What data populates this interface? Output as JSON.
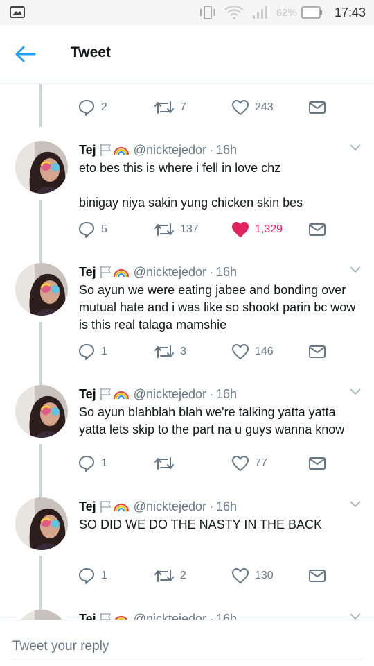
{
  "status_bar": {
    "battery_percent": "62%",
    "time": "17:43"
  },
  "app_bar": {
    "title": "Tweet"
  },
  "top_actions": {
    "replies": "2",
    "retweets": "7",
    "likes": "243"
  },
  "tweets": [
    {
      "name": "Tej",
      "handle": "@nicktejedor",
      "separator": "·",
      "time": "16h",
      "lines": [
        "eto bes this is where i fell in love chz",
        "binigay niya sakin yung chicken skin bes"
      ],
      "replies": "5",
      "retweets": "137",
      "likes": "1,329",
      "liked": true
    },
    {
      "name": "Tej",
      "handle": "@nicktejedor",
      "separator": "·",
      "time": "16h",
      "lines": [
        "So ayun we were eating jabee and bonding over mutual hate and i was like so shookt parin bc wow is this real talaga mamshie"
      ],
      "replies": "1",
      "retweets": "3",
      "likes": "146",
      "liked": false
    },
    {
      "name": "Tej",
      "handle": "@nicktejedor",
      "separator": "·",
      "time": "16h",
      "lines": [
        "So ayun blahblah blah we're talking yatta yatta yatta lets skip to the part na u guys wanna know"
      ],
      "replies": "1",
      "retweets": "",
      "likes": "77",
      "liked": false
    },
    {
      "name": "Tej",
      "handle": "@nicktejedor",
      "separator": "·",
      "time": "16h",
      "lines": [
        "SO DID WE DO THE NASTY IN THE BACK"
      ],
      "replies": "1",
      "retweets": "2",
      "likes": "130",
      "liked": false
    },
    {
      "name": "Tej",
      "handle": "@nicktejedor",
      "separator": "·",
      "time": "16h",
      "lines": [],
      "partial": true
    }
  ],
  "reply": {
    "placeholder": "Tweet your reply"
  },
  "icons": {
    "status_left": "image-icon",
    "vibrate": "vibrate-icon",
    "wifi": "wifi-icon",
    "signal": "signal-icon",
    "battery": "battery-icon",
    "back": "back-arrow-icon",
    "reply": "reply-icon",
    "retweet": "retweet-icon",
    "like": "heart-icon",
    "dm": "envelope-icon",
    "chevron": "chevron-down-icon",
    "flag": "white-flag-icon",
    "rainbow": "rainbow-icon"
  },
  "colors": {
    "accent": "#1da1f2",
    "like_active": "#e0245e",
    "muted": "#657786",
    "text": "#14171a",
    "thread_line": "#ccd6dd"
  }
}
